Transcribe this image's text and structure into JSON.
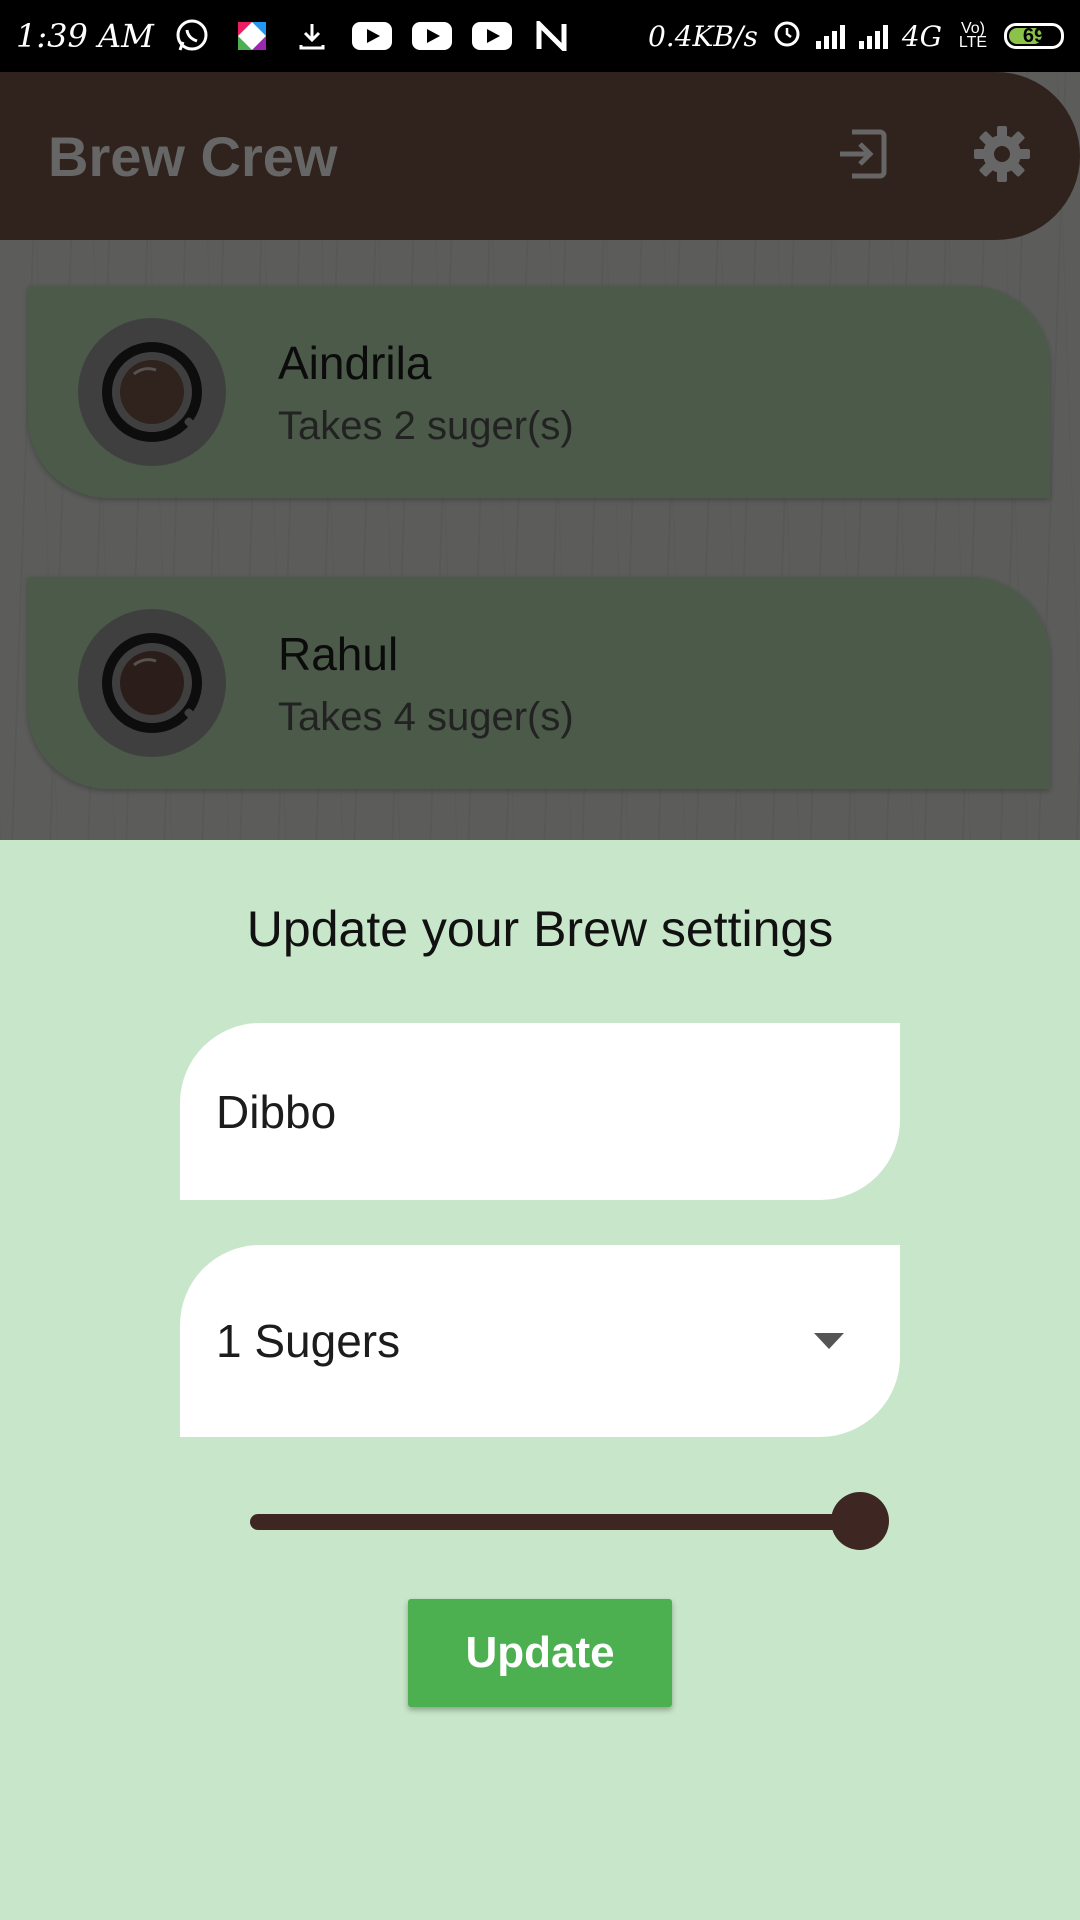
{
  "status_bar": {
    "time": "1:39 AM",
    "net_speed": "0.4KB/s",
    "network": "4G",
    "volte": "Vo) LTE",
    "battery": "69",
    "notification_icons": [
      "whatsapp-icon",
      "app-icon",
      "download-icon",
      "youtube-icon",
      "youtube-icon",
      "youtube-icon",
      "n-icon"
    ]
  },
  "appbar": {
    "title": "Brew Crew",
    "logout_icon": "logout-icon",
    "settings_icon": "gear-icon"
  },
  "brews": [
    {
      "name": "Aindrila",
      "subtitle": "Takes 2 suger(s)"
    },
    {
      "name": "Rahul",
      "subtitle": "Takes 4 suger(s)"
    }
  ],
  "sheet": {
    "title": "Update your Brew settings",
    "name_value": "Dibbo",
    "sugar_selected": "1 Sugers",
    "strength_fraction": 1.0,
    "update_label": "Update"
  },
  "colors": {
    "appbar": "#795548",
    "card": "#bce0b7",
    "sheet_bg": "#c8e6c9",
    "slider": "#3e2723",
    "button": "#4caf50"
  }
}
